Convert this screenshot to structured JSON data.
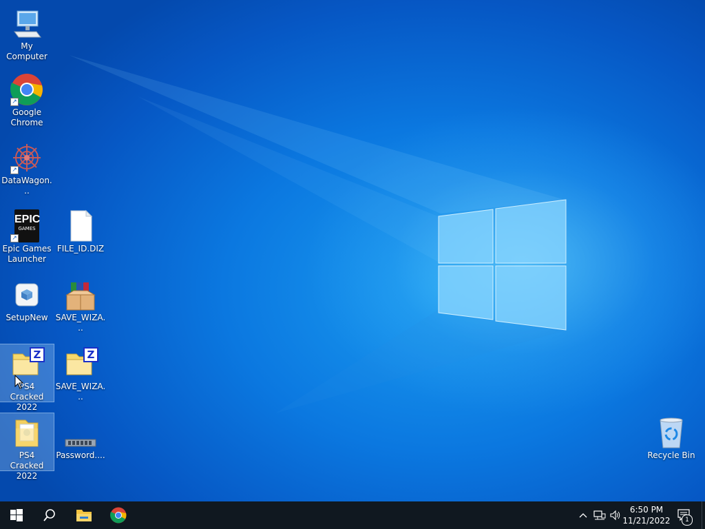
{
  "desktop": {
    "icons": [
      {
        "label": "My Computer"
      },
      {
        "label": "Google Chrome"
      },
      {
        "label": "DataWagon..."
      },
      {
        "label": "Epic Games Launcher"
      },
      {
        "label": "FILE_ID.DIZ"
      },
      {
        "label": "SetupNew"
      },
      {
        "label": "SAVE_WIZA..."
      },
      {
        "label": "PS4 Cracked 2022"
      },
      {
        "label": "SAVE_WIZA..."
      },
      {
        "label": "PS4 Cracked 2022"
      },
      {
        "label": "Password...."
      },
      {
        "label": "Recycle Bin"
      }
    ],
    "epic_logo_text": "EPIC",
    "epic_logo_sub": "GAMES",
    "zip_letter": "Z"
  },
  "taskbar": {
    "start_icon": "windows-logo-icon",
    "search_icon": "search-icon",
    "pinned": [
      "file-explorer-icon",
      "chrome-icon"
    ],
    "clock_time": "6:50 PM",
    "clock_date": "11/21/2022",
    "notification_count": "1"
  },
  "colors": {
    "taskbar": "#101820",
    "wallpaper_accent": "#0b78e0"
  }
}
